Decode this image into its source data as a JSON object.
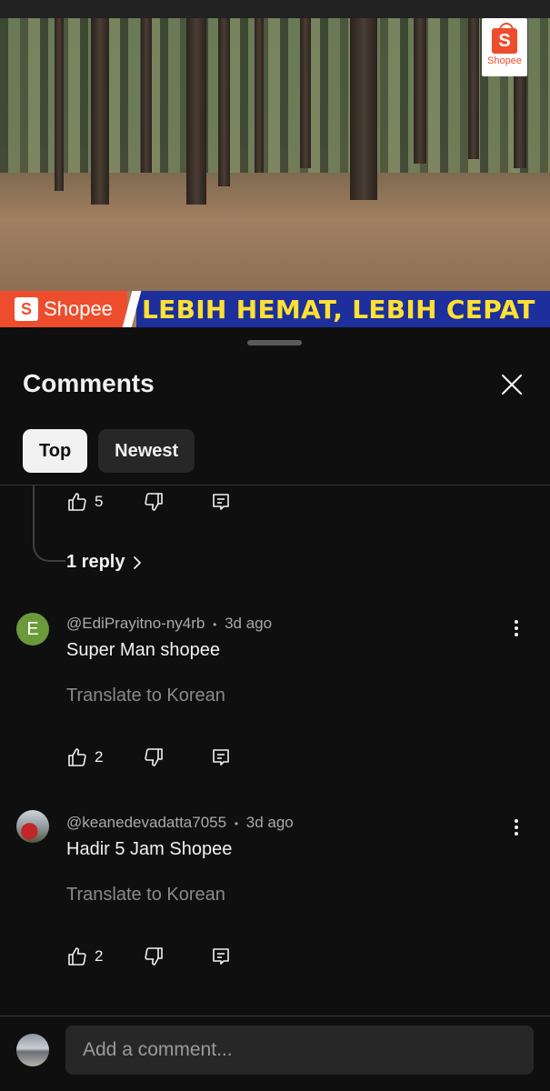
{
  "video": {
    "brand_corner": "Shopee",
    "brand_corner_glyph": "S",
    "banner_logo_glyph": "S",
    "banner_logo": "Shopee",
    "banner_text": "LEBIH HEMAT, LEBIH CEPAT",
    "colors": {
      "shopee_orange": "#ee4d2d",
      "banner_blue": "#1c2f9c",
      "banner_yellow": "#ffe033"
    }
  },
  "sheet": {
    "title": "Comments",
    "close_icon": "close-icon",
    "tabs": [
      {
        "label": "Top",
        "active": true
      },
      {
        "label": "Newest",
        "active": false
      }
    ]
  },
  "reply_actions": {
    "likes": "5"
  },
  "reply_link": {
    "label": "1 reply"
  },
  "comments": [
    {
      "avatar_letter": "E",
      "avatar_color": "#6a9a3b",
      "author": "@EdiPrayitno-ny4rb",
      "time": "3d ago",
      "separator": "•",
      "text": "Super Man shopee",
      "translate": "Translate to Korean",
      "likes": "2"
    },
    {
      "avatar_letter": "",
      "author": "@keanedevadatta7055",
      "time": "3d ago",
      "separator": "•",
      "text": "Hadir 5 Jam Shopee",
      "translate": "Translate to Korean",
      "likes": "2"
    }
  ],
  "composer": {
    "placeholder": "Add a comment..."
  }
}
